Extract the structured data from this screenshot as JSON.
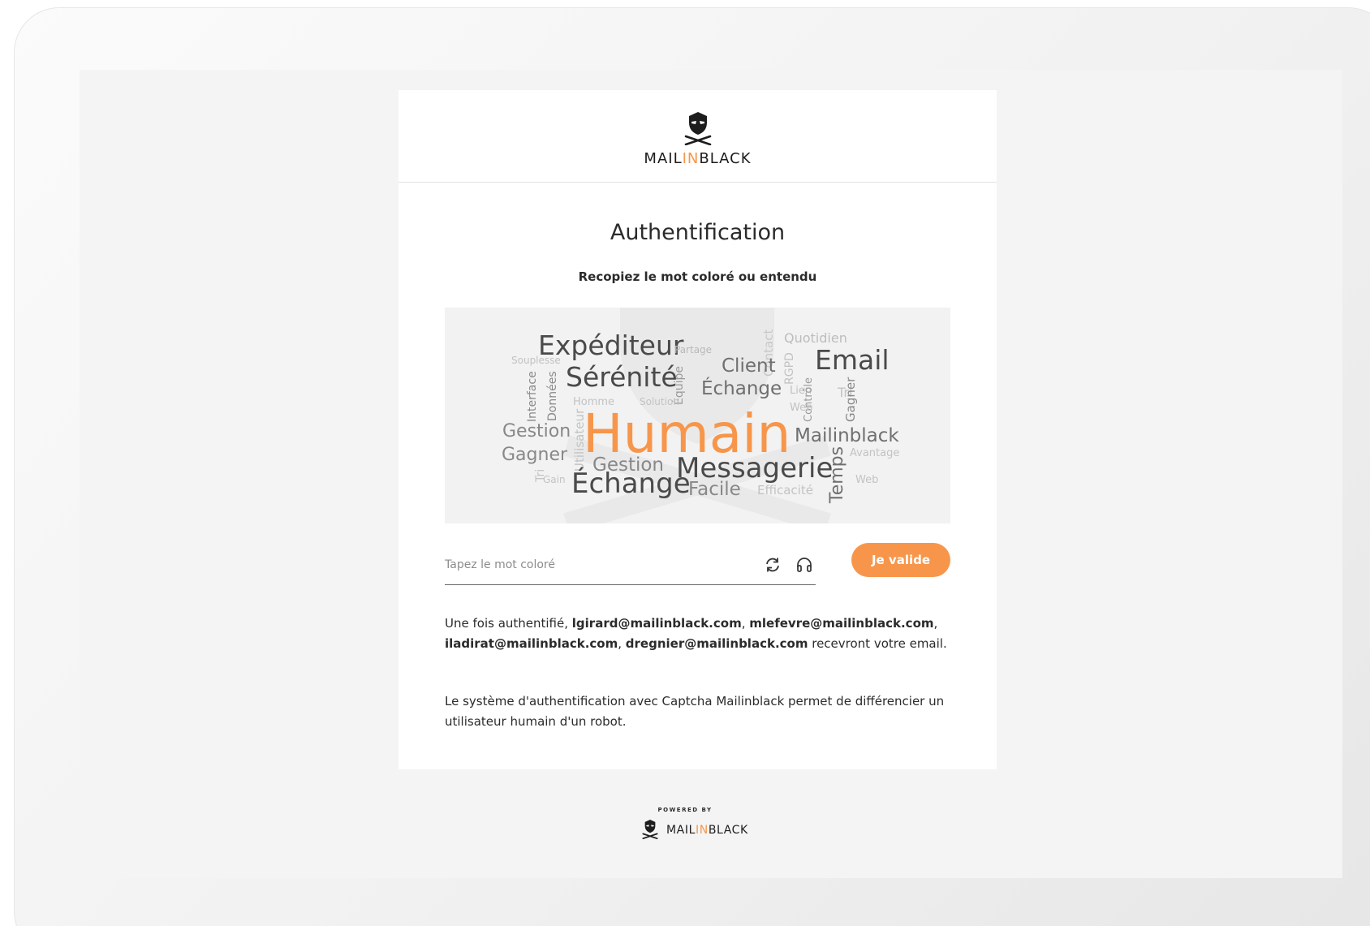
{
  "brand": {
    "logo_prefix": "MAIL",
    "logo_accent": "IN",
    "logo_suffix": "BLACK",
    "accent_color": "#f7964b",
    "logo_icon": "pirate-mask-icon"
  },
  "auth": {
    "title": "Authentification",
    "instruction": "Recopiez le mot coloré ou entendu"
  },
  "captcha": {
    "target_word": "Humain",
    "words": [
      {
        "text": "Expéditeur"
      },
      {
        "text": "Partage"
      },
      {
        "text": "Contact"
      },
      {
        "text": "Quotidien"
      },
      {
        "text": "Souplesse"
      },
      {
        "text": "Sérénité"
      },
      {
        "text": "Client"
      },
      {
        "text": "RGPD"
      },
      {
        "text": "Email"
      },
      {
        "text": "Interface"
      },
      {
        "text": "Données"
      },
      {
        "text": "Équipe"
      },
      {
        "text": "Échange"
      },
      {
        "text": "Lien"
      },
      {
        "text": "Contrôle"
      },
      {
        "text": "Tri"
      },
      {
        "text": "Gagner"
      },
      {
        "text": "Homme"
      },
      {
        "text": "Solution"
      },
      {
        "text": "Web"
      },
      {
        "text": "Gestion"
      },
      {
        "text": "Utilisateur"
      },
      {
        "text": "Humain"
      },
      {
        "text": "Mailinblack"
      },
      {
        "text": "Gagner"
      },
      {
        "text": "Avantage"
      },
      {
        "text": "Gestion"
      },
      {
        "text": "Messagerie"
      },
      {
        "text": "Temps"
      },
      {
        "text": "Tri"
      },
      {
        "text": "Gain"
      },
      {
        "text": "Échange"
      },
      {
        "text": "Facile"
      },
      {
        "text": "Efficacité"
      },
      {
        "text": "Web"
      }
    ],
    "input_placeholder": "Tapez le mot coloré",
    "refresh_icon": "refresh-icon",
    "audio_icon": "headphones-icon",
    "submit_label": "Je valide"
  },
  "info": {
    "recipients_prefix": "Une fois authentifié, ",
    "recipients": [
      "lgirard@mailinblack.com",
      "mlefevre@mailinblack.com",
      "iladirat@mailinblack.com",
      "dregnier@mailinblack.com"
    ],
    "sep": ", ",
    "recipients_suffix": " recevront votre email.",
    "captcha_note": "Le système d'authentification avec Captcha Mailinblack permet de différencier un utilisateur humain d'un robot."
  },
  "footer": {
    "powered_by": "POWERED BY",
    "logo_prefix": "MAIL",
    "logo_accent": "IN",
    "logo_suffix": "BLACK"
  }
}
